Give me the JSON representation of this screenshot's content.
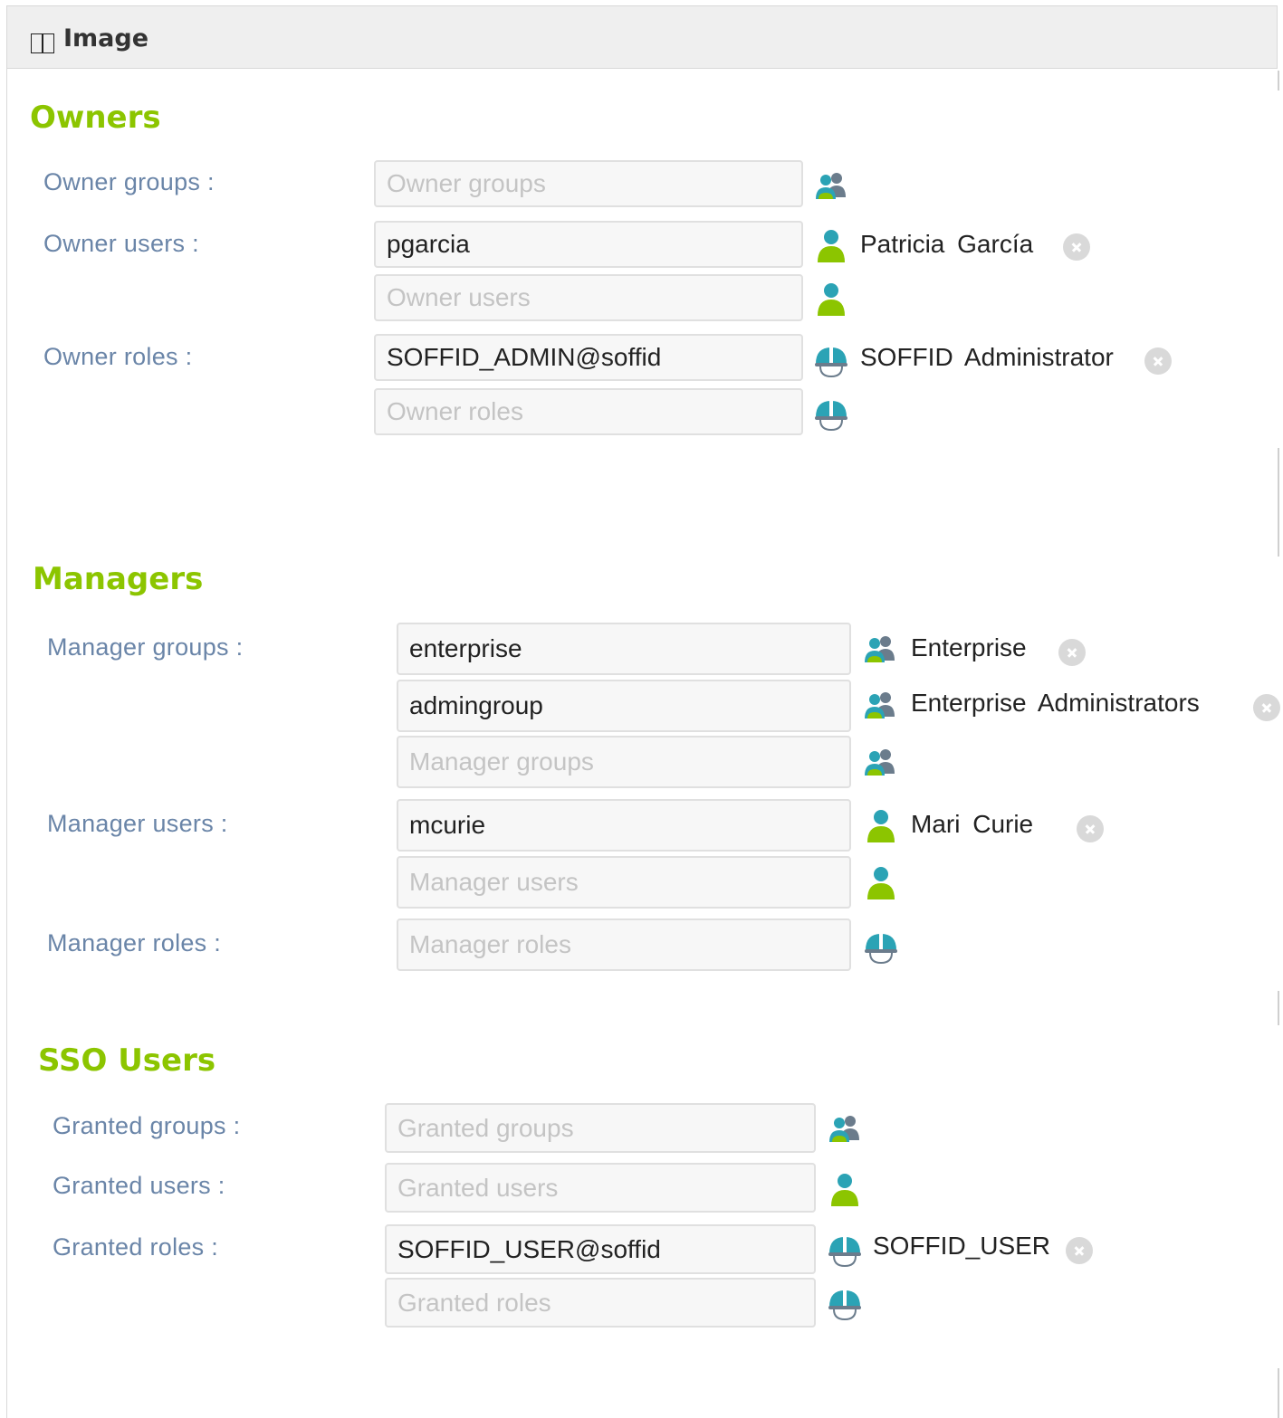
{
  "panel": {
    "title": "Image"
  },
  "owners": {
    "title": "Owners",
    "owner_groups_label": "Owner groups :",
    "owner_groups_placeholder": "Owner groups",
    "owner_users_label": "Owner users :",
    "owner_users_value": "pgarcia",
    "owner_users_name": "Patricia  García",
    "owner_users_placeholder": "Owner users",
    "owner_roles_label": "Owner roles :",
    "owner_roles_value": "SOFFID_ADMIN@soffid",
    "owner_roles_name": "SOFFID Administrator",
    "owner_roles_placeholder": "Owner roles"
  },
  "managers": {
    "title": "Managers",
    "manager_groups_label": "Manager groups :",
    "manager_groups_value1": "enterprise",
    "manager_groups_name1": "Enterprise",
    "manager_groups_value2": "admingroup",
    "manager_groups_name2": "Enterprise Administrators",
    "manager_groups_placeholder": "Manager groups",
    "manager_users_label": "Manager users :",
    "manager_users_value": "mcurie",
    "manager_users_name": "Mari  Curie",
    "manager_users_placeholder": "Manager users",
    "manager_roles_label": "Manager roles :",
    "manager_roles_placeholder": "Manager roles"
  },
  "sso": {
    "title": "SSO Users",
    "granted_groups_label": "Granted groups :",
    "granted_groups_placeholder": "Granted groups",
    "granted_users_label": "Granted users :",
    "granted_users_placeholder": "Granted users",
    "granted_roles_label": "Granted roles :",
    "granted_roles_value": "SOFFID_USER@soffid",
    "granted_roles_name": "SOFFID_USER",
    "granted_roles_placeholder": "Granted roles"
  },
  "colors": {
    "section_title": "#8cc500",
    "label": "#6a85a8",
    "icon_teal": "#2ba3b5",
    "icon_green": "#8cc500",
    "icon_gray": "#6b7c8c"
  },
  "icons": {
    "group": "group-icon",
    "user": "user-icon",
    "role": "role-helmet-icon",
    "remove": "remove-icon"
  }
}
